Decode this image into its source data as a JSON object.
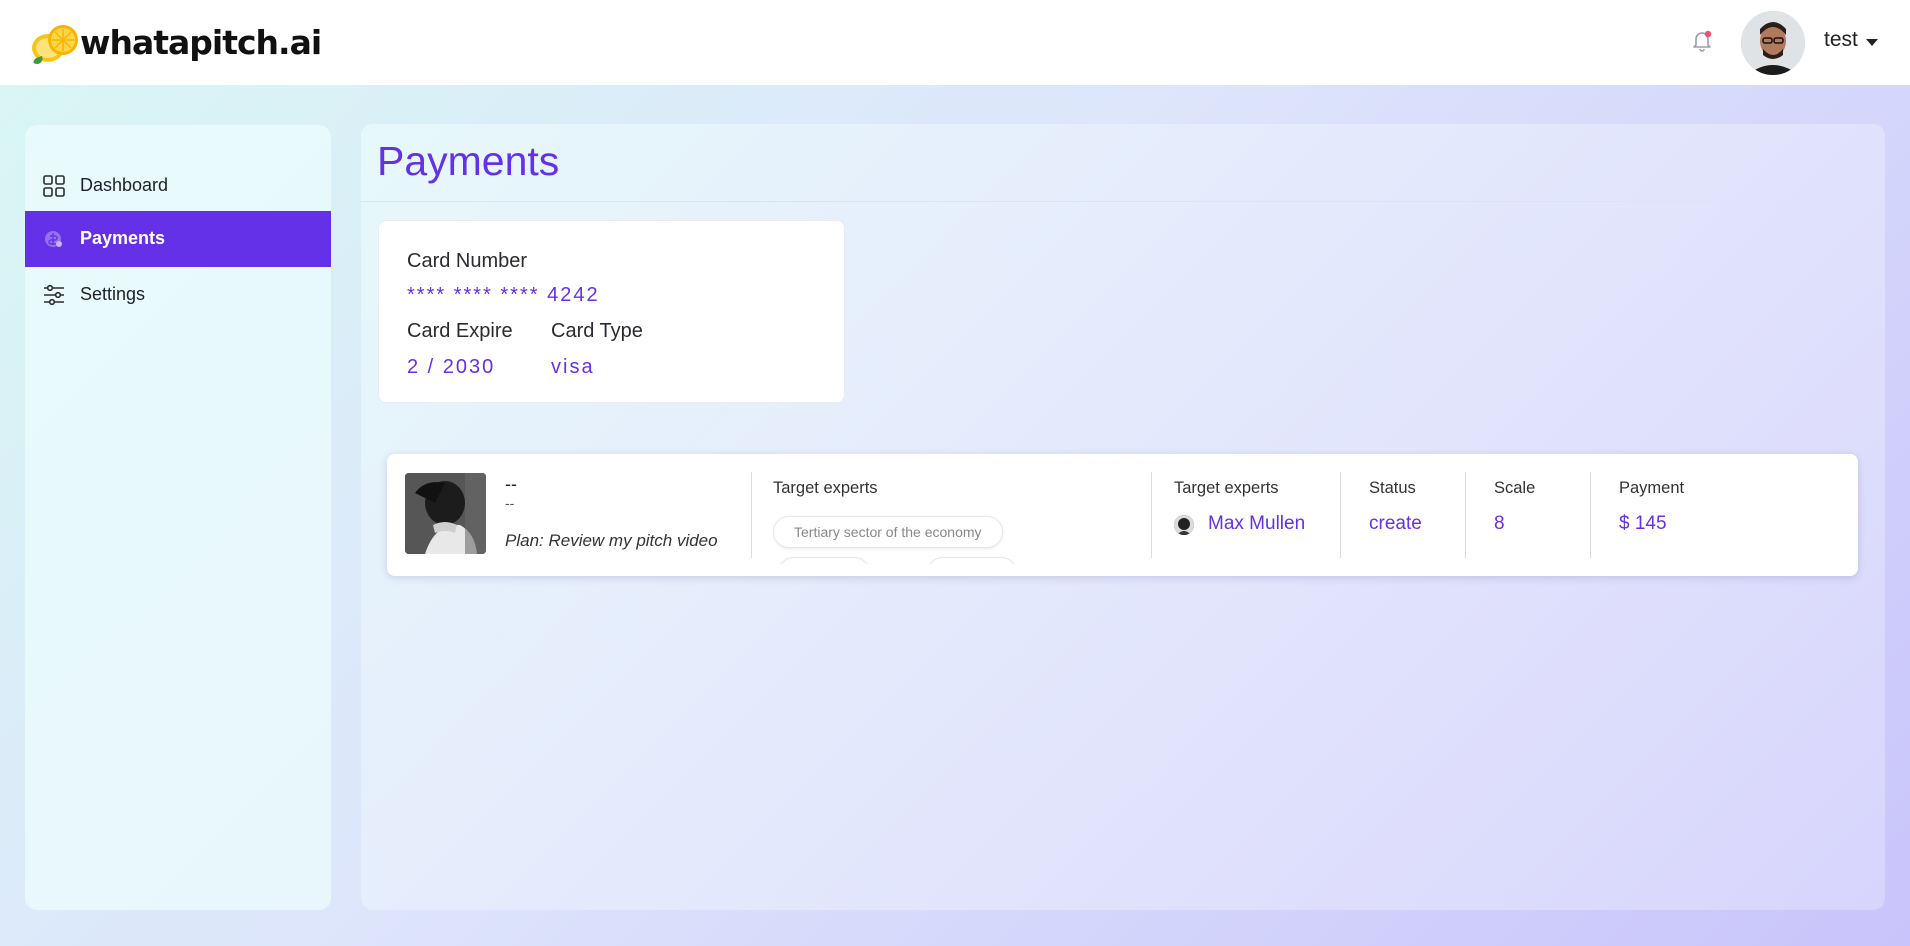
{
  "header": {
    "brand": "whatapitch.ai",
    "user_name": "test"
  },
  "sidebar": {
    "items": [
      {
        "label": "Dashboard",
        "icon": "grid-icon",
        "active": false
      },
      {
        "label": "Payments",
        "icon": "payment-shield-icon",
        "active": true
      },
      {
        "label": "Settings",
        "icon": "sliders-icon",
        "active": false
      }
    ]
  },
  "main": {
    "title": "Payments",
    "card": {
      "number_label": "Card Number",
      "number_value": "**** **** **** 4242",
      "expire_label": "Card Expire",
      "expire_value": "2 / 2030",
      "type_label": "Card Type",
      "type_value": "visa"
    },
    "payment_row": {
      "title": "--",
      "subtitle": "--",
      "plan": "Plan: Review my pitch video",
      "target_experts_label": "Target experts",
      "tags": [
        "Tertiary sector of the economy"
      ],
      "target_experts_label_2": "Target experts",
      "expert_name": "Max Mullen",
      "status_label": "Status",
      "status_value": "create",
      "scale_label": "Scale",
      "scale_value": "8",
      "payment_label": "Payment",
      "payment_value": "$ 145"
    }
  },
  "colors": {
    "accent": "#6431e8",
    "notification_dot": "#f0506e"
  }
}
